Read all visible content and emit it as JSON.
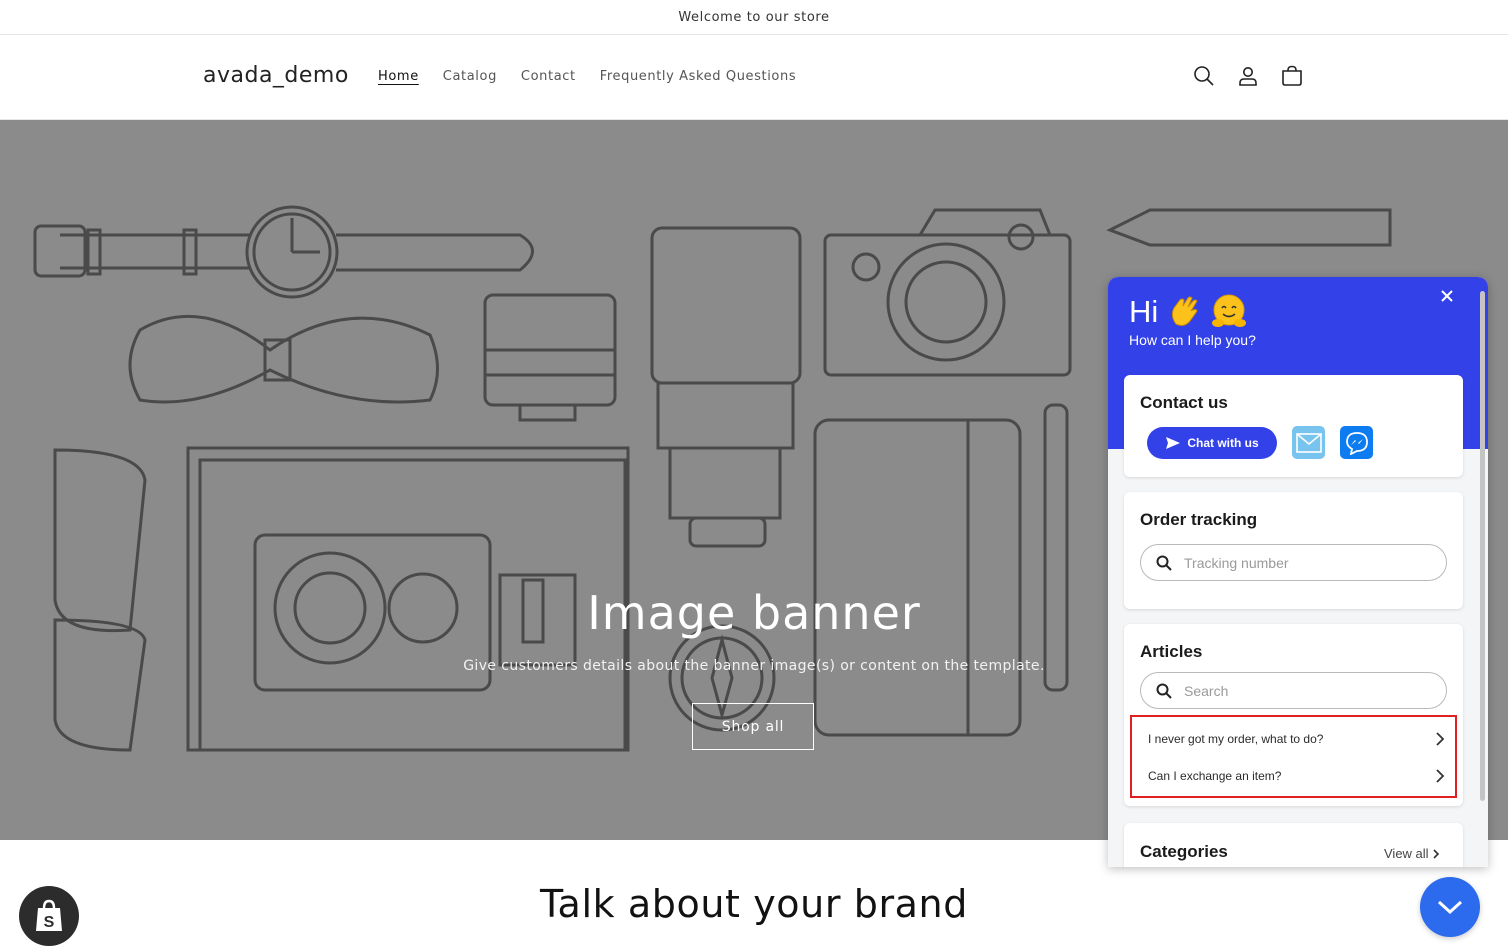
{
  "announcement": {
    "text": "Welcome to our store"
  },
  "header": {
    "logo": "avada_demo",
    "nav": [
      "Home",
      "Catalog",
      "Contact",
      "Frequently Asked Questions"
    ],
    "icons": [
      "search-icon",
      "account-icon",
      "cart-icon"
    ]
  },
  "banner": {
    "title": "Image banner",
    "subtitle": "Give customers details about the banner image(s) or content on the template.",
    "button": "Shop all"
  },
  "brand": {
    "heading": "Talk about your brand"
  },
  "widget": {
    "greeting": "Hi",
    "subtitle": "How can I help you?",
    "contact": {
      "title": "Contact us",
      "chat_label": "Chat with us"
    },
    "order_tracking": {
      "title": "Order tracking",
      "placeholder": "Tracking number"
    },
    "articles": {
      "title": "Articles",
      "placeholder": "Search",
      "items": [
        "I never got my order, what to do?",
        "Can I exchange an item?"
      ]
    },
    "categories": {
      "title": "Categories",
      "view_all": "View all"
    },
    "colors": {
      "accent": "#3341e8",
      "highlight": "#e02020",
      "toggle": "#2c6bed"
    }
  }
}
